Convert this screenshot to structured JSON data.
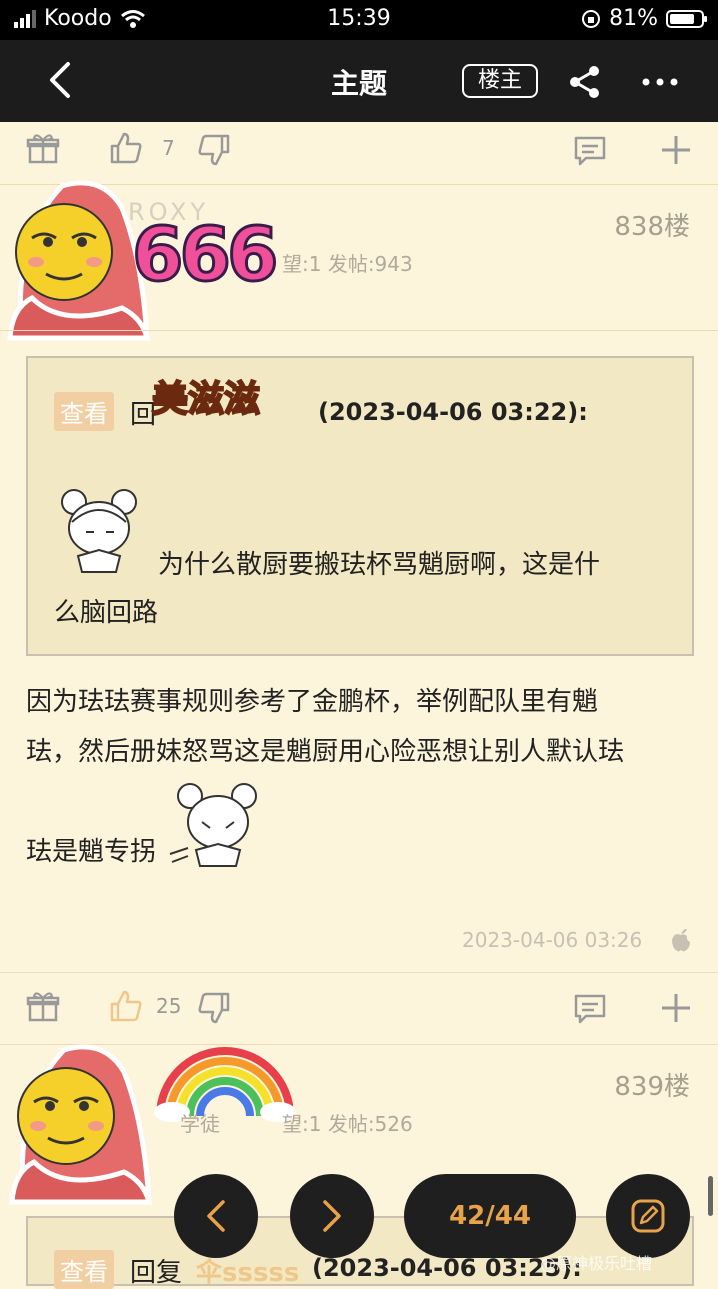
{
  "status_bar": {
    "carrier": "Koodo",
    "time": "15:39",
    "battery_percent": "81%",
    "battery_level": 0.81
  },
  "nav": {
    "title": "主题",
    "owner_button": "楼主"
  },
  "top_actions": {
    "like_count": "7"
  },
  "floor_838": {
    "username_partial": "ROXY",
    "meta": "望:1  发帖:943",
    "floor": "838楼",
    "sticker_text": "666",
    "quote": {
      "tag": "查看",
      "reply_prefix": "回",
      "sticker_text": "美滋滋",
      "time": "(2023-04-06 03:22):",
      "line1": "为什么散厨要搬珐杯骂魈厨啊，这是什",
      "line2": "么脑回路"
    },
    "body_line1": "因为珐珐赛事规则参考了金鹏杯，举例配队里有魈",
    "body_line2": "珐，然后册妹怒骂这是魈厨用心险恶想让别人默认珐",
    "body_line3": "珐是魈专拐",
    "post_time": "2023-04-06 03:26",
    "like_count": "25"
  },
  "floor_839": {
    "meta_left": "学徒",
    "meta": "望:1  发帖:526",
    "floor": "839楼",
    "quote": {
      "tag": "查看",
      "reply_prefix": "回复",
      "user": "伞sssss",
      "time": "(2023-04-06 03:25):"
    }
  },
  "pager": {
    "page": "42/44"
  },
  "watermark": "@原神极乐吐槽"
}
